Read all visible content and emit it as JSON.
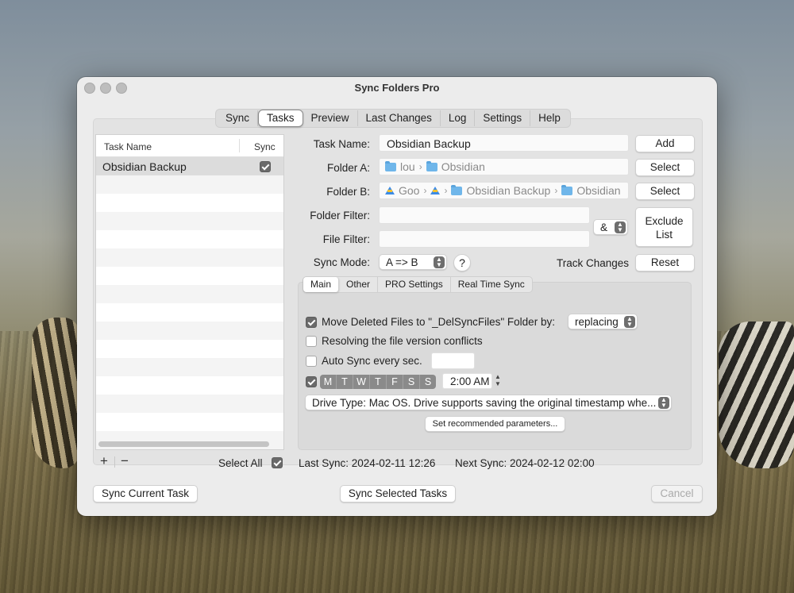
{
  "window": {
    "title": "Sync Folders Pro"
  },
  "tabs": [
    "Sync",
    "Tasks",
    "Preview",
    "Last Changes",
    "Log",
    "Settings",
    "Help"
  ],
  "active_tab": "Tasks",
  "task_list": {
    "col_name": "Task Name",
    "col_sync": "Sync",
    "rows": [
      {
        "name": "Obsidian Backup",
        "sync": true
      }
    ],
    "add": "+",
    "remove": "−",
    "select_all": "Select All"
  },
  "form": {
    "task_name_label": "Task Name:",
    "task_name_value": "Obsidian Backup",
    "folder_a_label": "Folder A:",
    "folder_a_path": [
      "lou",
      "Obsidian"
    ],
    "folder_b_label": "Folder B:",
    "folder_b_path": [
      "Goo",
      "",
      "Obsidian Backup",
      "Obsidian"
    ],
    "folder_filter_label": "Folder Filter:",
    "file_filter_label": "File Filter:",
    "filter_join": "&",
    "sync_mode_label": "Sync Mode:",
    "sync_mode_value": "A => B",
    "help": "?",
    "track_changes_label": "Track Changes"
  },
  "buttons": {
    "add": "Add",
    "select_a": "Select",
    "select_b": "Select",
    "exclude_line1": "Exclude",
    "exclude_line2": "List",
    "reset": "Reset",
    "sync_current": "Sync Current Task",
    "sync_selected": "Sync Selected Tasks",
    "cancel": "Cancel"
  },
  "subtabs": [
    "Main",
    "Other",
    "PRO Settings",
    "Real Time Sync"
  ],
  "active_subtab": "Main",
  "options": {
    "move_deleted": "Move Deleted Files to \"_DelSyncFiles\" Folder by:",
    "move_deleted_checked": true,
    "move_deleted_mode": "replacing",
    "resolve_conflicts": "Resolving the file version conflicts",
    "resolve_checked": false,
    "auto_sync": "Auto Sync every sec.",
    "auto_sync_checked": false,
    "schedule_checked": true,
    "days": [
      "M",
      "T",
      "W",
      "T",
      "F",
      "S",
      "S"
    ],
    "time": "2:00 AM",
    "drive_type": "Drive Type: Mac OS. Drive supports saving the original timestamp whe...",
    "recommended": "Set recommended parameters..."
  },
  "status": {
    "last_sync": "Last Sync: 2024-02-11 12:26",
    "next_sync": "Next Sync: 2024-02-12 02:00"
  }
}
